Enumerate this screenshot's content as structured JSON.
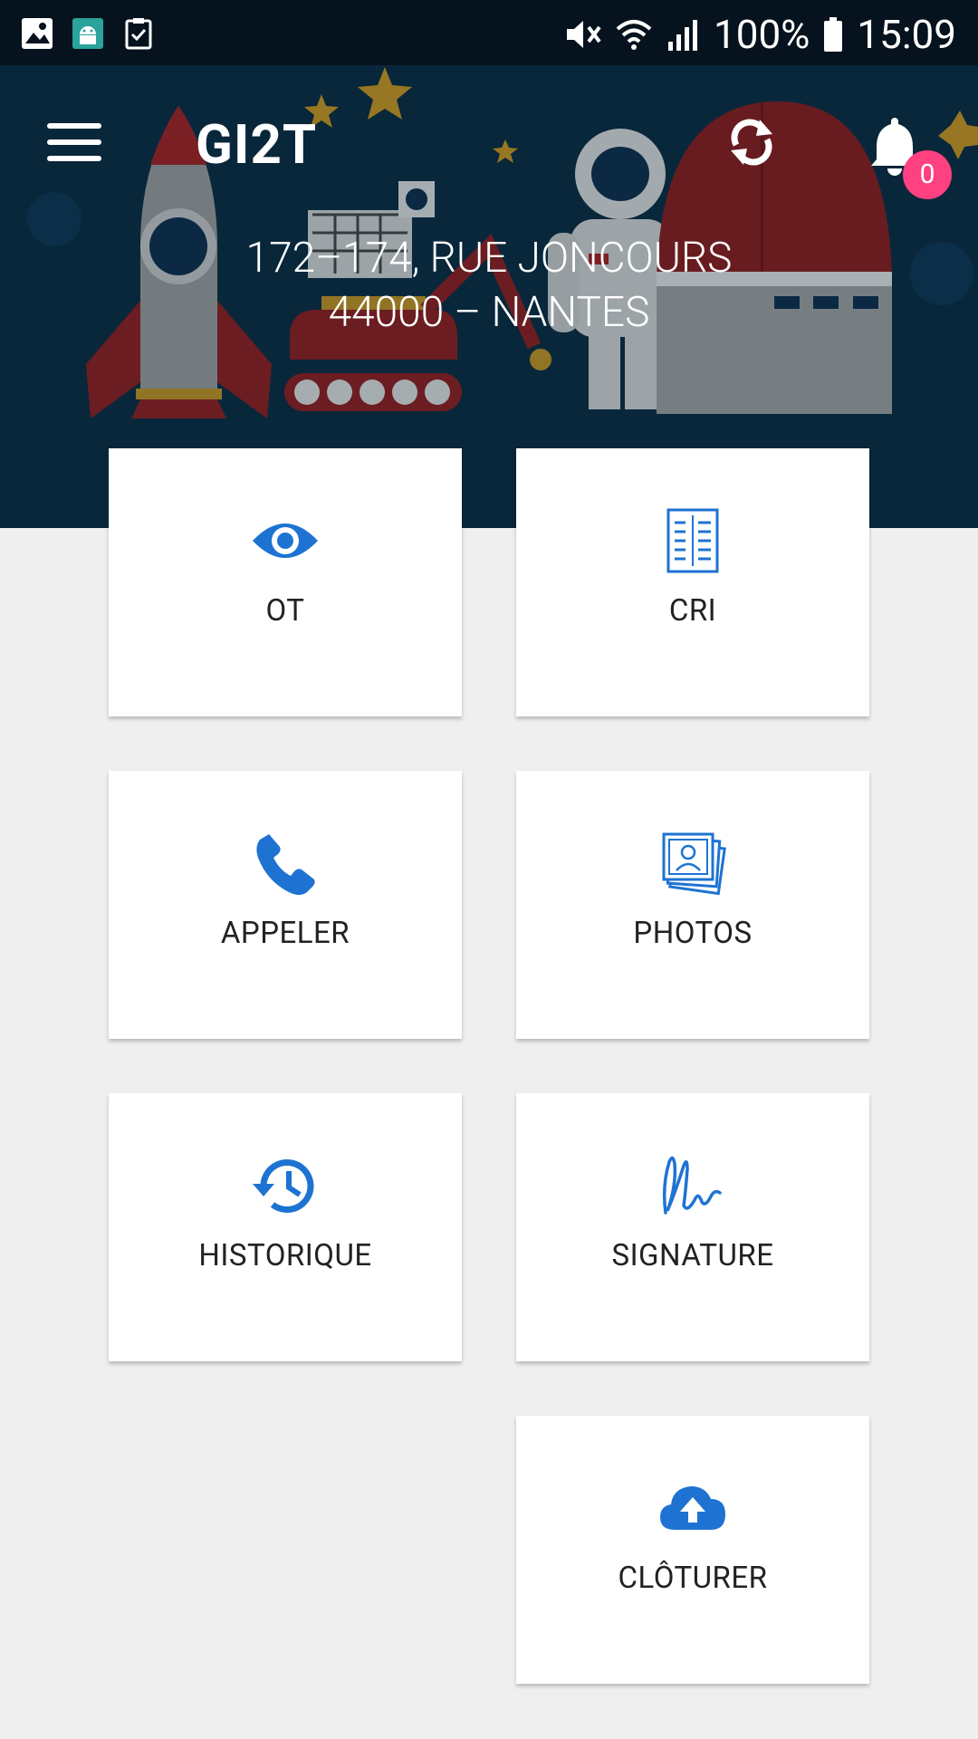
{
  "status_bar": {
    "battery": "100%",
    "time": "15:09",
    "icons": [
      "gallery-icon",
      "android-debug-icon",
      "clipboard-check-icon",
      "mute-icon",
      "wifi-icon",
      "signal-icon",
      "battery-icon"
    ]
  },
  "header": {
    "title": "GI2T",
    "menu_icon": "hamburger-menu-icon",
    "sync_icon": "sync-icon",
    "notification_icon": "bell-icon",
    "notification_count": "0"
  },
  "address": {
    "line1": "172–174, RUE JONCOURS",
    "line2": "44000 – NANTES"
  },
  "tiles": [
    {
      "label": "OT",
      "icon": "eye-icon"
    },
    {
      "label": "CRI",
      "icon": "document-list-icon"
    },
    {
      "label": "APPELER",
      "icon": "phone-icon"
    },
    {
      "label": "PHOTOS",
      "icon": "photos-stack-icon"
    },
    {
      "label": "HISTORIQUE",
      "icon": "history-icon"
    },
    {
      "label": "SIGNATURE",
      "icon": "signature-icon"
    },
    {
      "label": "CLÔTURER",
      "icon": "cloud-upload-icon"
    }
  ],
  "colors": {
    "accent": "#1e73d2",
    "badge": "#ff4081",
    "hero_bg": "#0b2a3f",
    "page_bg": "#efefef"
  }
}
